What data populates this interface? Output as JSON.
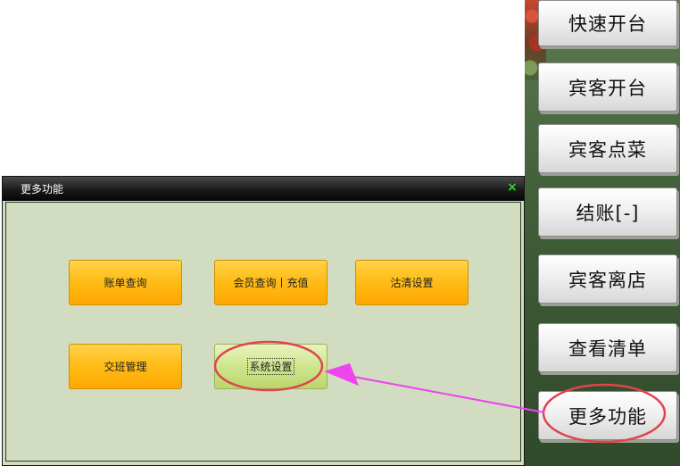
{
  "sidebar": {
    "buttons": [
      {
        "label": "快速开台"
      },
      {
        "label": "宾客开台"
      },
      {
        "label": "宾客点菜"
      },
      {
        "label": "结账[-]"
      },
      {
        "label": "宾客离店"
      },
      {
        "label": "查看清单"
      },
      {
        "label": "更多功能"
      }
    ]
  },
  "dialog": {
    "title": "更多功能",
    "close_glyph": "×",
    "buttons": [
      {
        "label": "账单查询"
      },
      {
        "label": "会员查询丨充值"
      },
      {
        "label": "沽清设置"
      },
      {
        "label": "交班管理"
      },
      {
        "label": "系统设置"
      }
    ]
  },
  "colors": {
    "annotation": "#e0444e",
    "arrow": "#ee44ee",
    "dialog_bg": "#d1dcc0",
    "accent_orange": "#ffb40a",
    "accent_green": "#c6df7c"
  }
}
